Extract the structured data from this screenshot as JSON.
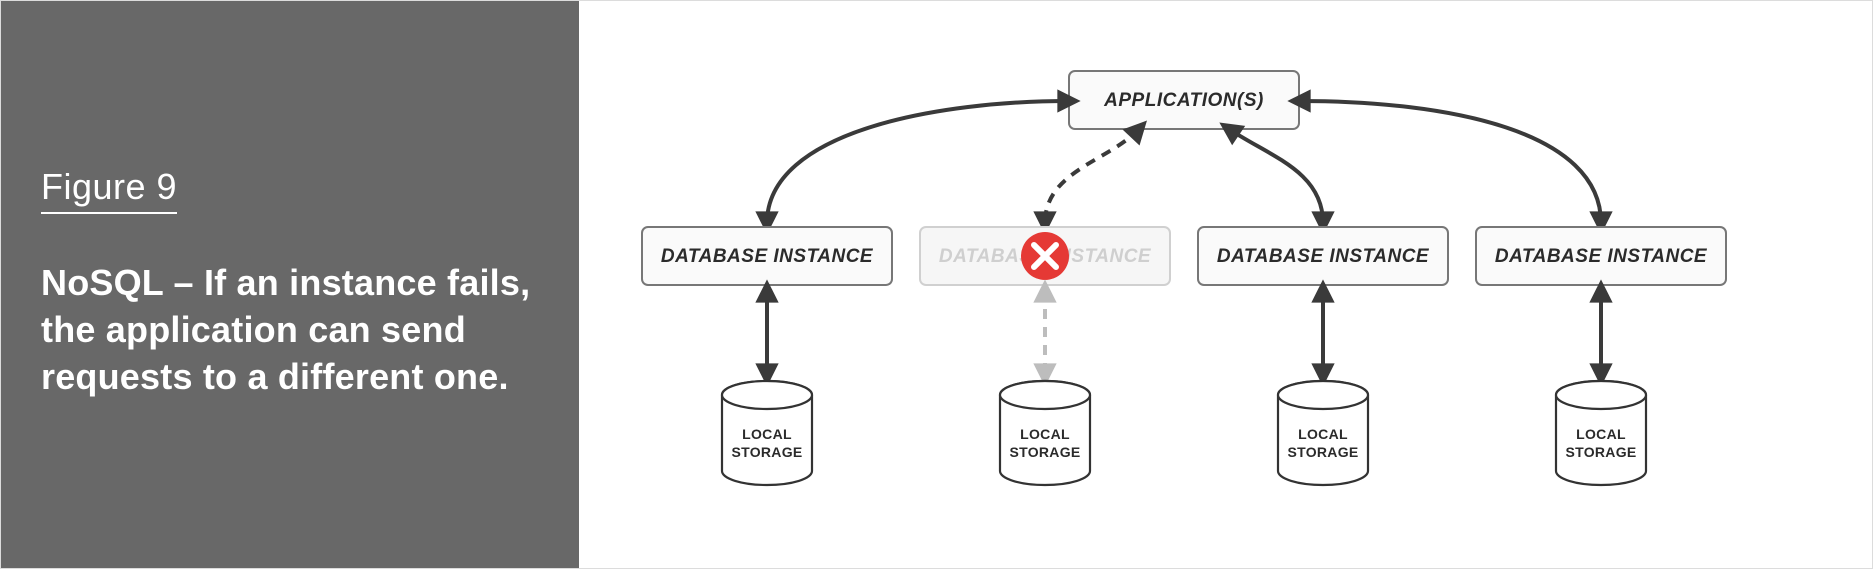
{
  "figure": {
    "label": "Figure 9",
    "caption": "NoSQL – If an instance fails, the application can send requests to a different one."
  },
  "diagram": {
    "application": "APPLICATION(S)",
    "instances": [
      {
        "label": "DATABASE INSTANCE",
        "failed": false
      },
      {
        "label": "DATABASE INSTANCE",
        "failed": true
      },
      {
        "label": "DATABASE INSTANCE",
        "failed": false
      },
      {
        "label": "DATABASE INSTANCE",
        "failed": false
      }
    ],
    "storage_line1": "LOCAL",
    "storage_line2": "STORAGE",
    "fail_icon": "error-icon"
  }
}
